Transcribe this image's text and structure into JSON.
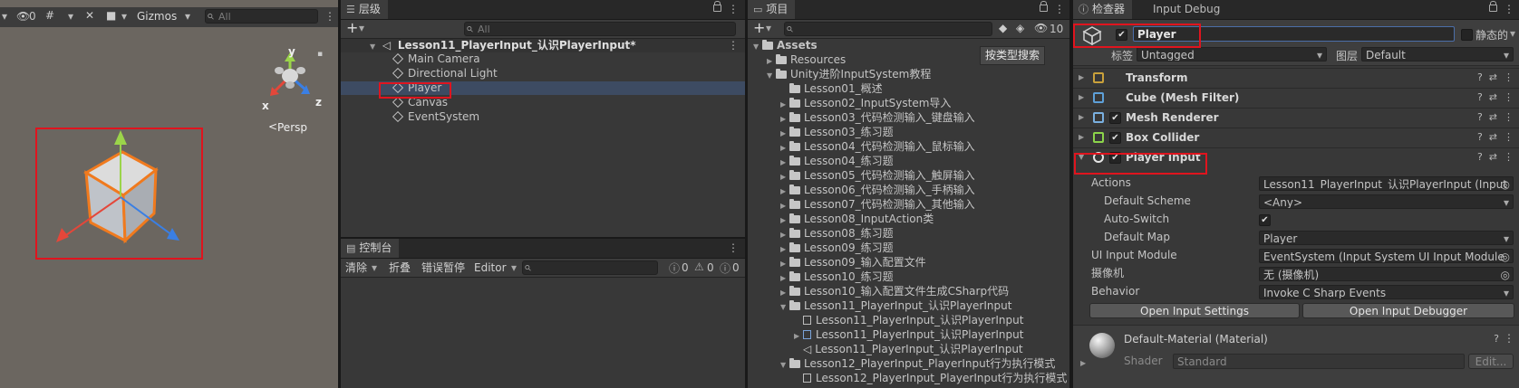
{
  "scene": {
    "toolbar": {
      "hidden_count": "0",
      "gizmos_label": "Gizmos",
      "search_placeholder": "All"
    },
    "axis_y": "y",
    "axis_x": "x",
    "axis_z": "z",
    "persp_label": "Persp"
  },
  "hierarchy": {
    "tab_label": "层级",
    "plus_label": "+",
    "search_placeholder": "All",
    "scene_name": "Lesson11_PlayerInput_认识PlayerInput*",
    "items": [
      {
        "label": "Main Camera"
      },
      {
        "label": "Directional Light"
      },
      {
        "label": "Player"
      },
      {
        "label": "Canvas"
      },
      {
        "label": "EventSystem"
      }
    ]
  },
  "console": {
    "tab_label": "控制台",
    "buttons": {
      "clear": "清除",
      "collapse": "折叠",
      "error_pause": "错误暂停",
      "editor": "Editor"
    },
    "counts": {
      "log": "0",
      "warn": "0",
      "error": "0"
    }
  },
  "project": {
    "tab_label": "项目",
    "plus_label": "+",
    "search_type_label": "按类型搜索",
    "hidden_count": "10",
    "tree": [
      {
        "label": "Assets",
        "level": 0,
        "kind": "folder",
        "open": true
      },
      {
        "label": "Resources",
        "level": 1,
        "kind": "folder"
      },
      {
        "label": "Unity进阶InputSystem教程",
        "level": 1,
        "kind": "folder",
        "open": true
      },
      {
        "label": "Lesson01_概述",
        "level": 2,
        "kind": "folder",
        "leaf": true
      },
      {
        "label": "Lesson02_InputSystem导入",
        "level": 2,
        "kind": "folder"
      },
      {
        "label": "Lesson03_代码检测输入_键盘输入",
        "level": 2,
        "kind": "folder"
      },
      {
        "label": "Lesson03_练习题",
        "level": 2,
        "kind": "folder"
      },
      {
        "label": "Lesson04_代码检测输入_鼠标输入",
        "level": 2,
        "kind": "folder"
      },
      {
        "label": "Lesson04_练习题",
        "level": 2,
        "kind": "folder"
      },
      {
        "label": "Lesson05_代码检测输入_触屏输入",
        "level": 2,
        "kind": "folder"
      },
      {
        "label": "Lesson06_代码检测输入_手柄输入",
        "level": 2,
        "kind": "folder"
      },
      {
        "label": "Lesson07_代码检测输入_其他输入",
        "level": 2,
        "kind": "folder"
      },
      {
        "label": "Lesson08_InputAction类",
        "level": 2,
        "kind": "folder"
      },
      {
        "label": "Lesson08_练习题",
        "level": 2,
        "kind": "folder"
      },
      {
        "label": "Lesson09_练习题",
        "level": 2,
        "kind": "folder"
      },
      {
        "label": "Lesson09_输入配置文件",
        "level": 2,
        "kind": "folder"
      },
      {
        "label": "Lesson10_练习题",
        "level": 2,
        "kind": "folder"
      },
      {
        "label": "Lesson10_输入配置文件生成CSharp代码",
        "level": 2,
        "kind": "folder"
      },
      {
        "label": "Lesson11_PlayerInput_认识PlayerInput",
        "level": 2,
        "kind": "folder",
        "open": true
      },
      {
        "label": "Lesson11_PlayerInput_认识PlayerInput",
        "level": 3,
        "kind": "script"
      },
      {
        "label": "Lesson11_PlayerInput_认识PlayerInput",
        "level": 3,
        "kind": "asset"
      },
      {
        "label": "Lesson11_PlayerInput_认识PlayerInput",
        "level": 3,
        "kind": "scene"
      },
      {
        "label": "Lesson12_PlayerInput_PlayerInput行为执行模式",
        "level": 2,
        "kind": "folder",
        "open": true
      },
      {
        "label": "Lesson12_PlayerInput_PlayerInput行为执行模式",
        "level": 3,
        "kind": "script"
      }
    ]
  },
  "inspector": {
    "tab_label": "检查器",
    "tab2_label": "Input Debug",
    "object_name": "Player",
    "static_label": "静态的",
    "tag_label": "标签",
    "tag_value": "Untagged",
    "layer_label": "图层",
    "layer_value": "Default",
    "components": [
      {
        "label": "Transform",
        "has_check": false,
        "icon": "transform-icon"
      },
      {
        "label": "Cube (Mesh Filter)",
        "has_check": false,
        "icon": "mesh-filter-icon"
      },
      {
        "label": "Mesh Renderer",
        "has_check": true,
        "icon": "mesh-renderer-icon"
      },
      {
        "label": "Box Collider",
        "has_check": true,
        "icon": "box-collider-icon"
      },
      {
        "label": "Player Input",
        "has_check": true,
        "icon": "player-input-icon"
      }
    ],
    "props": [
      {
        "label": "Actions",
        "value": "Lesson11_PlayerInput_认识PlayerInput (Input",
        "indent": 0,
        "kind": "object"
      },
      {
        "label": "Default Scheme",
        "value": "<Any>",
        "indent": 1,
        "kind": "dropdown"
      },
      {
        "label": "Auto-Switch",
        "value": "✔",
        "indent": 1,
        "kind": "check"
      },
      {
        "label": "Default Map",
        "value": "Player",
        "indent": 1,
        "kind": "dropdown"
      },
      {
        "label": "UI Input Module",
        "value": "EventSystem (Input System UI Input Module",
        "indent": 0,
        "kind": "object"
      },
      {
        "label": "摄像机",
        "value": "无 (摄像机)",
        "indent": 0,
        "kind": "object"
      },
      {
        "label": "Behavior",
        "value": "Invoke C Sharp Events",
        "indent": 0,
        "kind": "dropdown"
      }
    ],
    "open_settings_label": "Open Input Settings",
    "open_debugger_label": "Open Input Debugger",
    "material": {
      "name": "Default-Material (Material)",
      "shader_label": "Shader",
      "shader_value": "Standard",
      "edit_label": "Edit..."
    },
    "colors": {
      "highlight": "#e0141e",
      "selection": "#3d4b62"
    }
  }
}
